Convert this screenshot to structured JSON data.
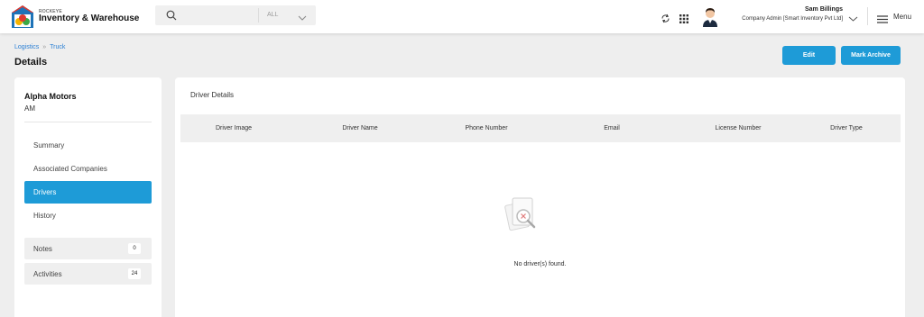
{
  "brand": {
    "small": "ROCKEYE",
    "name": "Inventory & Warehouse"
  },
  "search": {
    "placeholder": "",
    "scope": "ALL"
  },
  "user": {
    "name": "Sam Billings",
    "role": "Company Admin [Smart Inventory Pvt Ltd]"
  },
  "menu": {
    "label": "Menu"
  },
  "breadcrumb": {
    "items": [
      "Logistics",
      "Truck"
    ],
    "separator": "»"
  },
  "page": {
    "title": "Details"
  },
  "actions": {
    "edit": "Edit",
    "archive": "Mark Archive"
  },
  "company": {
    "name": "Alpha Motors",
    "abbr": "AM"
  },
  "nav": {
    "items": [
      {
        "label": "Summary",
        "active": false
      },
      {
        "label": "Associated Companies",
        "active": false
      },
      {
        "label": "Drivers",
        "active": true
      },
      {
        "label": "History",
        "active": false
      }
    ]
  },
  "counts": [
    {
      "label": "Notes",
      "count": "0"
    },
    {
      "label": "Activities",
      "count": "24"
    }
  ],
  "driver_details": {
    "title": "Driver Details",
    "columns": [
      "Driver Image",
      "Driver Name",
      "Phone Number",
      "Email",
      "License Number",
      "Driver Type"
    ],
    "empty_message": "No driver(s) found."
  },
  "icons": [
    "logo-icon",
    "search-icon",
    "chevron-down-icon",
    "refresh-icon",
    "apps-grid-icon",
    "avatar",
    "hamburger-icon",
    "empty-state-icon"
  ],
  "colors": {
    "primary": "#1e9bd7",
    "link": "#2a7fd4"
  }
}
